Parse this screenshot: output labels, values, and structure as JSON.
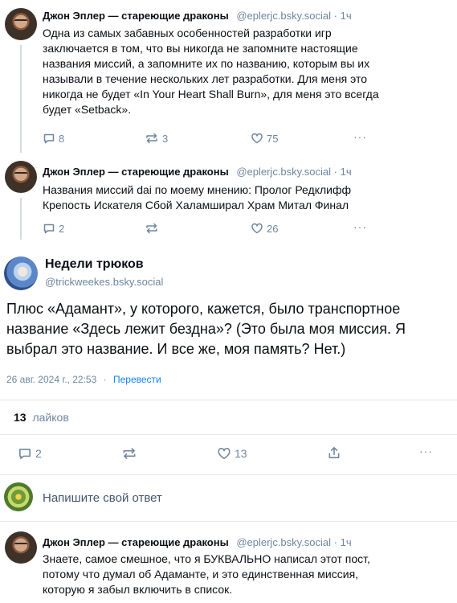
{
  "post1": {
    "author": "Джон Эплер — стареющие драконы",
    "handle": "@eplerjc.bsky.social",
    "time": "· 1ч",
    "lines": [
      "Одна из самых забавных особенностей разработки игр",
      "заключается в том, что вы никогда не запомните настоящие",
      "названия миссий, а запомните их по названию, которым вы их",
      "называли в течение нескольких лет разработки. Для меня это",
      "никогда не будет «In Your Heart Shall Burn», для меня это всегда",
      "будет «Setback»."
    ],
    "replies": "8",
    "reposts": "3",
    "likes": "75",
    "more": "···"
  },
  "post2": {
    "author": "Джон Эплер — стареющие драконы",
    "handle": "@eplerjc.bsky.social",
    "time": "· 1ч",
    "lines": [
      "Названия миссий dai по моему мнению: Пролог Редклифф",
      "Крепость Искателя Сбой Халамширал Храм Митал Финал"
    ],
    "replies": "2",
    "reposts": "",
    "likes": "26",
    "more": "···"
  },
  "main_post": {
    "author": "Недели трюков",
    "handle": "@trickweekes.bsky.social",
    "lines": [
      "Плюс «Адамант», у которого, кажется, было транспортное",
      "название «Здесь лежит бездна»? (Это была моя миссия. Я",
      "выбрал это название. И все же, моя память? Нет.)"
    ],
    "date": "26 авг. 2024 г., 22:53",
    "sep": "·",
    "translate": "Перевести",
    "likes_count": "13",
    "likes_label": "лайков",
    "replies": "2",
    "likes": "13",
    "more": "···"
  },
  "reply_box": {
    "placeholder": "Напишите свой ответ"
  },
  "post3": {
    "author": "Джон Эплер — стареющие драконы",
    "handle": "@eplerjc.bsky.social",
    "time": "· 1ч",
    "lines": [
      "Знаете, самое смешное, что я БУКВАЛЬНО написал этот пост,",
      "потому что думал об Адаманте, и это единственная миссия,",
      "которую я забыл включить в список."
    ]
  },
  "icons": {
    "reply": "reply-bubble-icon",
    "repost": "repost-arrows-icon",
    "like": "heart-icon",
    "share": "share-icon",
    "more": "ellipsis-icon"
  },
  "colors": {
    "muted": "#6f869f",
    "link": "#1083fe",
    "divider": "#e3e8ee"
  }
}
